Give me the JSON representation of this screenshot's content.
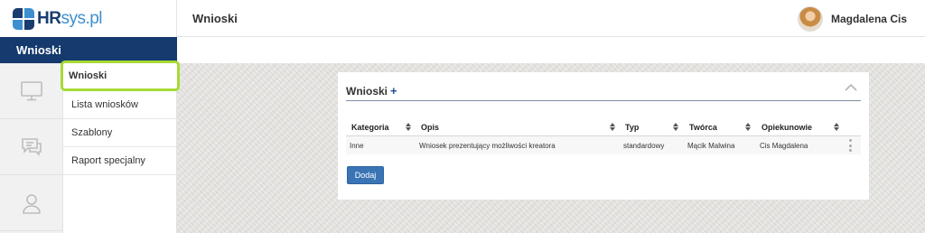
{
  "brand": {
    "name_bold": "HR",
    "name_light": "sys.pl"
  },
  "topbar": {
    "title": "Wnioski"
  },
  "user": {
    "name": "Magdalena Cis"
  },
  "sidebar": {
    "header": "Wnioski",
    "icons": [
      "monitor-icon",
      "chat-icon",
      "user-icon"
    ],
    "submenu": [
      {
        "label": "Wnioski",
        "active": true
      },
      {
        "label": "Lista wniosków"
      },
      {
        "label": "Szablony"
      },
      {
        "label": "Raport specjalny"
      }
    ]
  },
  "panel": {
    "title": "Wnioski",
    "add_symbol": "+",
    "columns": [
      "Kategoria",
      "Opis",
      "Typ",
      "Twórca",
      "Opiekunowie"
    ],
    "rows": [
      [
        "Inne",
        "Wniosek prezentujący możliwości kreatora",
        "standardowy",
        "Mącik Malwina",
        "Cis Magdalena"
      ]
    ],
    "add_button": "Dodaj"
  },
  "colors": {
    "sidebar_header": "#153a6e",
    "active_outline": "#a6da34",
    "button": "#3a74b5"
  }
}
